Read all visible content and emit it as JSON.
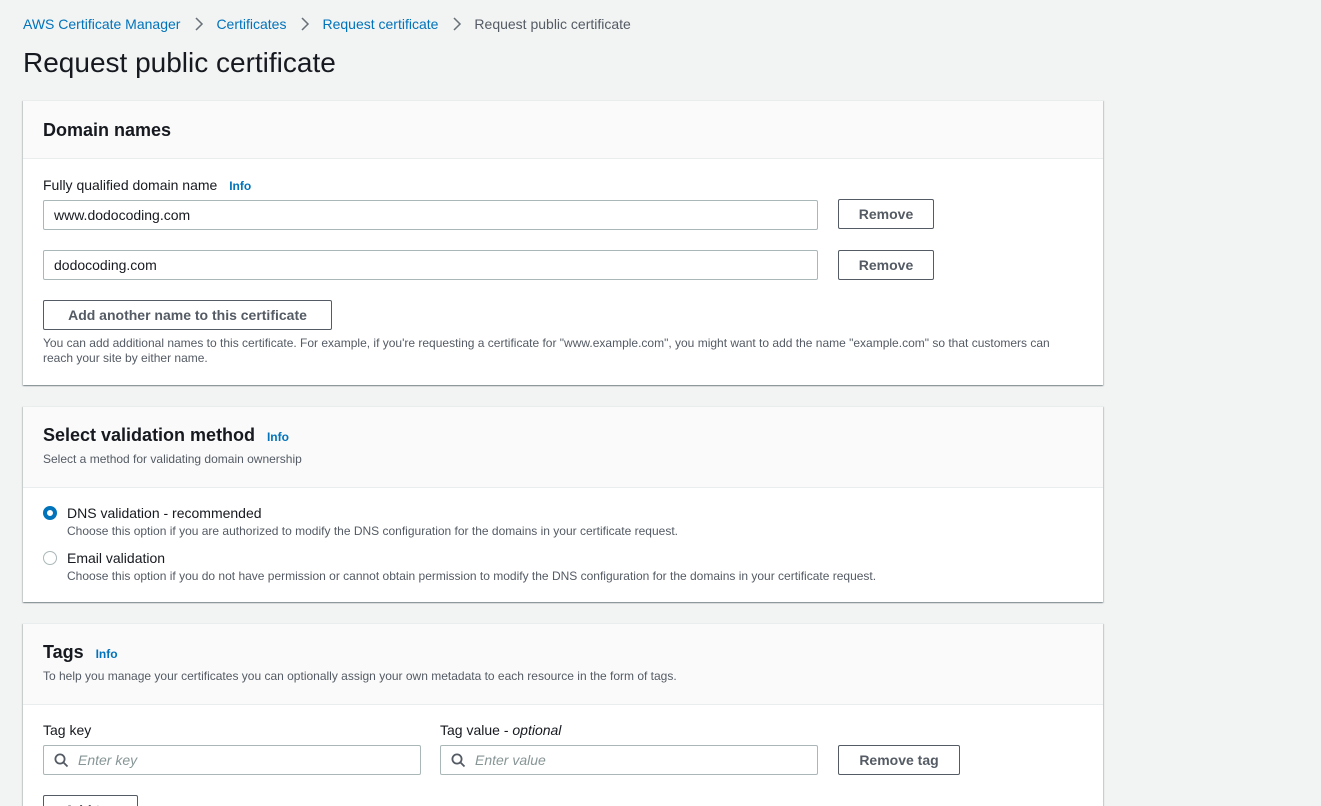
{
  "breadcrumb": {
    "items": [
      "AWS Certificate Manager",
      "Certificates",
      "Request certificate"
    ],
    "current": "Request public certificate"
  },
  "page": {
    "title": "Request public certificate"
  },
  "domain_names": {
    "title": "Domain names",
    "field_label": "Fully qualified domain name",
    "info": "Info",
    "entries": [
      {
        "value": "www.dodocoding.com",
        "remove_label": "Remove"
      },
      {
        "value": "dodocoding.com",
        "remove_label": "Remove"
      }
    ],
    "add_button": "Add another name to this certificate",
    "help_text": "You can add additional names to this certificate. For example, if you're requesting a certificate for \"www.example.com\", you might want to add the name \"example.com\" so that customers can reach your site by either name."
  },
  "validation": {
    "title": "Select validation method",
    "info": "Info",
    "description": "Select a method for validating domain ownership",
    "options": [
      {
        "label": "DNS validation - recommended",
        "description": "Choose this option if you are authorized to modify the DNS configuration for the domains in your certificate request.",
        "selected": true
      },
      {
        "label": "Email validation",
        "description": "Choose this option if you do not have permission or cannot obtain permission to modify the DNS configuration for the domains in your certificate request.",
        "selected": false
      }
    ]
  },
  "tags": {
    "title": "Tags",
    "info": "Info",
    "description": "To help you manage your certificates you can optionally assign your own metadata to each resource in the form of tags.",
    "key_label": "Tag key",
    "value_label": "Tag value - ",
    "value_optional": "optional",
    "key_placeholder": "Enter key",
    "value_placeholder": "Enter value",
    "remove_tag": "Remove tag",
    "add_tag": "Add tag"
  },
  "colors": {
    "link": "#0073bb",
    "background": "#f2f3f3",
    "text": "#16191f",
    "secondary_text": "#545b64"
  }
}
